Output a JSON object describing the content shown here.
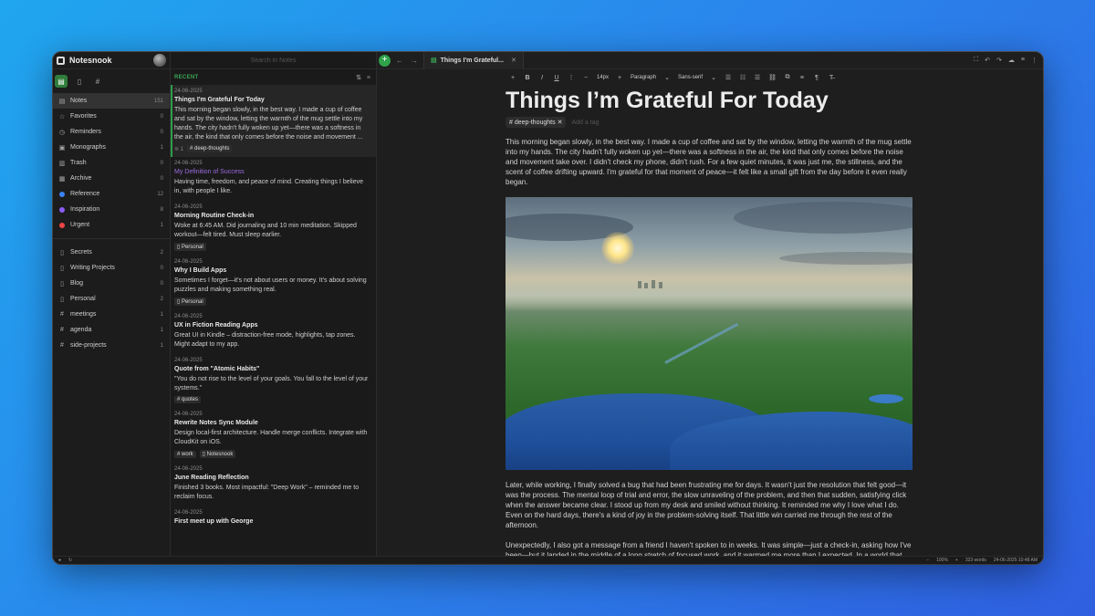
{
  "app": {
    "name": "Notesnook"
  },
  "sidebar": {
    "items": [
      {
        "label": "Notes",
        "count": "151",
        "icon": "note-icon",
        "active": true
      },
      {
        "label": "Favorites",
        "count": "0",
        "icon": "star-icon"
      },
      {
        "label": "Reminders",
        "count": "0",
        "icon": "bell-icon"
      },
      {
        "label": "Monographs",
        "count": "1",
        "icon": "monograph-icon"
      },
      {
        "label": "Trash",
        "count": "0",
        "icon": "trash-icon"
      },
      {
        "label": "Archive",
        "count": "0",
        "icon": "archive-icon"
      },
      {
        "label": "Reference",
        "count": "12",
        "color": "#3b82f6"
      },
      {
        "label": "Inspiration",
        "count": "8",
        "color": "#8b5cf6"
      },
      {
        "label": "Urgent",
        "count": "1",
        "color": "#ef4444"
      }
    ],
    "notebooks": [
      {
        "label": "Secrets",
        "count": "2",
        "icon": "notebook-icon"
      },
      {
        "label": "Writing Projects",
        "count": "0",
        "icon": "notebook-icon"
      },
      {
        "label": "Blog",
        "count": "0",
        "icon": "notebook-icon"
      },
      {
        "label": "Personal",
        "count": "2",
        "icon": "notebook-icon"
      },
      {
        "label": "meetings",
        "count": "1",
        "icon": "hash-icon"
      },
      {
        "label": "agenda",
        "count": "1",
        "icon": "hash-icon"
      },
      {
        "label": "side-projects",
        "count": "1",
        "icon": "hash-icon"
      }
    ]
  },
  "notelist": {
    "search_placeholder": "Search in Notes",
    "section": "RECENT",
    "notes": [
      {
        "date": "24-06-2025",
        "title": "Things I'm Grateful For Today",
        "body": "This morning began slowly, in the best way. I made a cup of coffee and sat by the window, letting the warmth of the mug settle into my hands. The city hadn't fully woken up yet—there was a softness in the air, the kind that only comes before the noise and movement ...",
        "meta": "1",
        "tags": [
          "# deep-thoughts"
        ],
        "active": true
      },
      {
        "date": "24-06-2025",
        "title": "My Definition of Success",
        "body": "Having time, freedom, and peace of mind. Creating things I believe in, with people I like.",
        "purple": true,
        "tags": []
      },
      {
        "date": "24-06-2025",
        "title": "Morning Routine Check-in",
        "body": "Woke at 6:45 AM. Did journaling and 10 min meditation. Skipped workout—felt tired. Must sleep earlier.",
        "tags": [
          "Personal"
        ]
      },
      {
        "date": "24-06-2025",
        "title": "Why I Build Apps",
        "body": "Sometimes I forget—it's not about users or money. It's about solving puzzles and making something real.",
        "tags": [
          "Personal"
        ]
      },
      {
        "date": "24-06-2025",
        "title": "UX in Fiction Reading Apps",
        "body": "Great UI in Kindle – distraction-free mode, highlights, tap zones. Might adapt to my app.",
        "tags": []
      },
      {
        "date": "24-06-2025",
        "title": "Quote from \"Atomic Habits\"",
        "body": "\"You do not rise to the level of your goals. You fall to the level of your systems.\"",
        "tags": [
          "# quotes"
        ]
      },
      {
        "date": "24-06-2025",
        "title": "Rewrite Notes Sync Module",
        "body": "Design local-first architecture. Handle merge conflicts. Integrate with CloudKit on iOS.",
        "tags": [
          "# work",
          "Notesnook"
        ]
      },
      {
        "date": "24-06-2025",
        "title": "June Reading Reflection",
        "body": "Finished 3 books. Most impactful: \"Deep Work\" – reminded me to reclaim focus.",
        "tags": []
      },
      {
        "date": "24-06-2025",
        "title": "First meet up with George",
        "body": "",
        "tags": []
      }
    ]
  },
  "editor": {
    "tab_title": "Things I'm Grateful...",
    "toolbar": {
      "font_size": "14px",
      "block": "Paragraph",
      "font": "Sans-serif"
    },
    "title": "Things I’m Grateful For Today",
    "tag": "# deep-thoughts",
    "add_tag_placeholder": "Add a tag",
    "p1": "This morning began slowly, in the best way. I made a cup of coffee and sat by the window, letting the warmth of the mug settle into my hands. The city hadn't fully woken up yet—there was a softness in the air, the kind that only comes before the noise and movement take over. I didn't check my phone, didn't rush. For a few quiet minutes, it was just me, the stillness, and the scent of coffee drifting upward. I'm grateful for that moment of peace—it felt like a small gift from the day before it even really began.",
    "p2": "Later, while working, I finally solved a bug that had been frustrating me for days. It wasn't just the resolution that felt good—it was the process. The mental loop of trial and error, the slow unraveling of the problem, and then that sudden, satisfying click when the answer became clear. I stood up from my desk and smiled without thinking. It reminded me why I love what I do. Even on the hard days, there's a kind of joy in the problem-solving itself. That little win carried me through the rest of the afternoon.",
    "p3": "Unexpectedly, I also got a message from a friend I haven't spoken to in weeks. It was simple—just a check-in, asking how I've been—but it landed in the middle of a long stretch of focused work, and it warmed me more than I expected. In a world that moves fast and leaves little space for pause, it meant something to be remembered. That small"
  },
  "status": {
    "zoom": "100%",
    "words": "323 words",
    "datetime": "24-06-2025 10:48 AM"
  }
}
